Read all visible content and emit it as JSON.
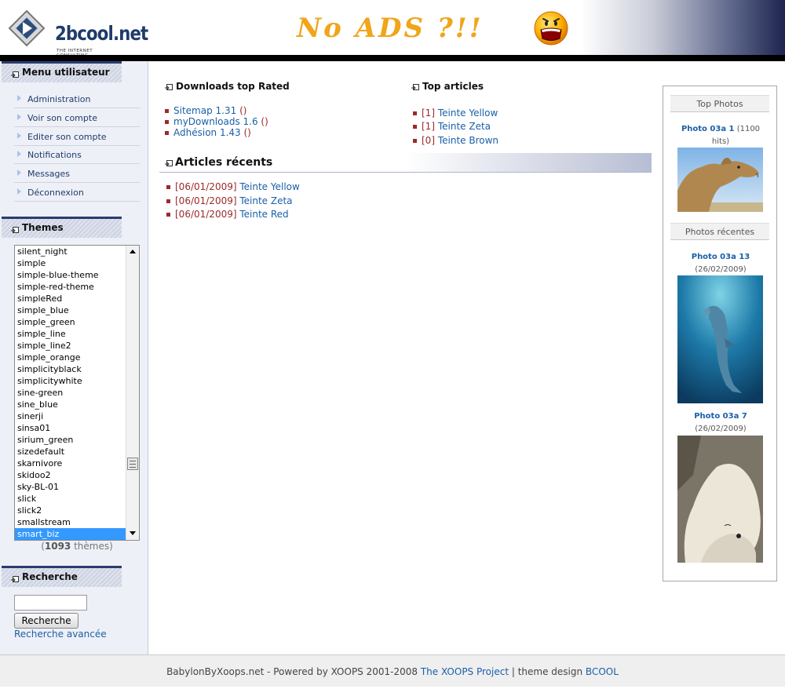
{
  "header": {
    "logo_text": "2bcool.net",
    "logo_sub": "THE INTERNET CONSULTING",
    "banner_text": "No ADS ?!!"
  },
  "left": {
    "user_menu": {
      "title": "Menu utilisateur",
      "items": [
        "Administration",
        "Voir son compte",
        "Editer son compte",
        "Notifications",
        "Messages",
        "Déconnexion"
      ]
    },
    "themes": {
      "title": "Themes",
      "options": [
        "silent_night",
        "simple",
        "simple-blue-theme",
        "simple-red-theme",
        "simpleRed",
        "simple_blue",
        "simple_green",
        "simple_line",
        "simple_line2",
        "simple_orange",
        "simplicityblack",
        "simplicitywhite",
        "sine-green",
        "sine_blue",
        "sinerji",
        "sinsa01",
        "sirium_green",
        "sizedefault",
        "skarnivore",
        "skidoo2",
        "sky-BL-01",
        "slick",
        "slick2",
        "smallstream",
        "smart_biz"
      ],
      "selected": "smart_biz",
      "count_open": "(",
      "count": "1093",
      "count_label": " thèmes)"
    },
    "search": {
      "title": "Recherche",
      "button": "Recherche",
      "advanced": "Recherche avancée",
      "value": ""
    }
  },
  "center": {
    "downloads": {
      "title": "Downloads top Rated",
      "items": [
        {
          "name": "Sitemap 1.31",
          "count": "()"
        },
        {
          "name": "myDownloads 1.6",
          "count": "()"
        },
        {
          "name": "Adhésion 1.43",
          "count": "()"
        }
      ]
    },
    "top_articles": {
      "title": "Top articles",
      "items": [
        {
          "num": "[1]",
          "title": "Teinte Yellow"
        },
        {
          "num": "[1]",
          "title": "Teinte Zeta"
        },
        {
          "num": "[0]",
          "title": "Teinte Brown"
        }
      ]
    },
    "recent_articles": {
      "title": "Articles récents",
      "items": [
        {
          "date": "[06/01/2009]",
          "title": "Teinte Yellow"
        },
        {
          "date": "[06/01/2009]",
          "title": "Teinte Zeta"
        },
        {
          "date": "[06/01/2009]",
          "title": "Teinte Red"
        }
      ]
    }
  },
  "right": {
    "top_photos": {
      "title": "Top Photos",
      "photo_title": "Photo 03a 1",
      "hits_part1": " (1100",
      "hits_part2": "hits)"
    },
    "recent_photos": {
      "title": "Photos récentes",
      "items": [
        {
          "title": "Photo 03a 13",
          "date": "(26/02/2009)"
        },
        {
          "title": "Photo 03a 7",
          "date": "(26/02/2009)"
        }
      ]
    }
  },
  "footer": {
    "text_before": "BabylonByXoops.net - Powered by XOOPS 2001-2008 ",
    "link1": "The XOOPS Project",
    "separator": " | theme design ",
    "link2": "BCOOL"
  },
  "colors": {
    "link": "#1a5fa8",
    "accent_red": "#9b2a2a",
    "header_bar": "#000000",
    "block_title_border": "#2b3c6e",
    "selected_option": "#3399ff"
  }
}
